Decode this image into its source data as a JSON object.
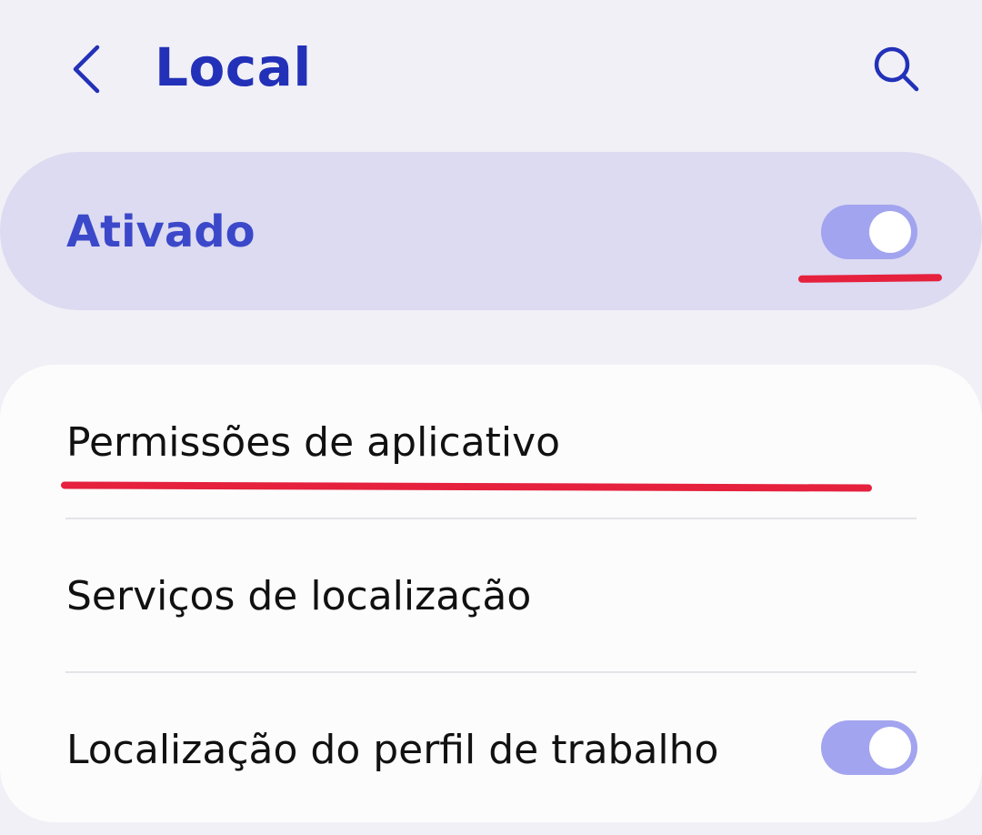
{
  "header": {
    "back_icon": "chevron-left-icon",
    "title": "Local",
    "search_icon": "search-icon"
  },
  "master": {
    "label": "Ativado",
    "enabled": true
  },
  "items": [
    {
      "label": "Permissões de aplicativo"
    },
    {
      "label": "Serviços de localização"
    },
    {
      "label": "Localização do perfil de trabalho",
      "toggle_enabled": true
    }
  ],
  "colors": {
    "accent": "#2231b8",
    "master_label": "#3b48c9",
    "toggle_on": "#a2a4ef",
    "highlight_mark": "#e5213d",
    "background": "#f1f0f6"
  }
}
